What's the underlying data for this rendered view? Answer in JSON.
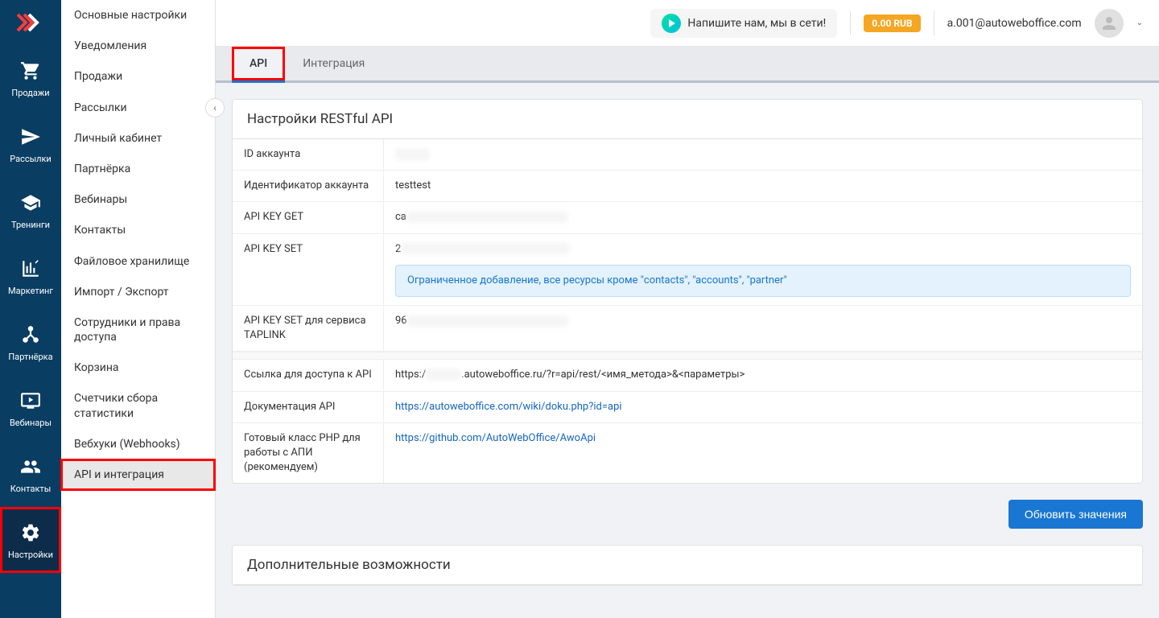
{
  "primaryNav": [
    {
      "label": "Продажи",
      "icon": "cart"
    },
    {
      "label": "Рассылки",
      "icon": "send"
    },
    {
      "label": "Тренинги",
      "icon": "graduation"
    },
    {
      "label": "Маркетинг",
      "icon": "chart"
    },
    {
      "label": "Партнёрка",
      "icon": "network"
    },
    {
      "label": "Вебинары",
      "icon": "monitor"
    },
    {
      "label": "Контакты",
      "icon": "users"
    },
    {
      "label": "Настройки",
      "icon": "gear"
    }
  ],
  "secondaryNav": [
    "Основные настройки",
    "Уведомления",
    "Продажи",
    "Рассылки",
    "Личный кабинет",
    "Партнёрка",
    "Вебинары",
    "Контакты",
    "Файловое хранилище",
    "Импорт / Экспорт",
    "Сотрудники и права доступа",
    "Корзина",
    "Счетчики сбора статистики",
    "Вебхуки (Webhooks)",
    "API и интеграция"
  ],
  "activeSecondaryIndex": 14,
  "topbar": {
    "chatText": "Напишите нам, мы в сети!",
    "balance": "0.00 RUB",
    "email": "a.001@autoweboffice.com"
  },
  "tabs": [
    {
      "label": "API",
      "active": true,
      "highlighted": true
    },
    {
      "label": "Интеграция",
      "active": false,
      "highlighted": false
    }
  ],
  "panel1": {
    "title": "Настройки RESTful API",
    "rows": {
      "accountId": {
        "label": "ID аккаунта",
        "prefix": "",
        "maskWidth": 42
      },
      "accountIdent": {
        "label": "Идентификатор аккаунта",
        "value": "testtest"
      },
      "apiKeyGet": {
        "label": "API KEY GET",
        "prefix": "ca",
        "maskWidth": 200
      },
      "apiKeySet": {
        "label": "API KEY SET",
        "prefix": "2",
        "maskWidth": 210,
        "info": "Ограниченное добавление, все ресурсы кроме \"contacts\", \"accounts\", \"partner\""
      },
      "apiKeyTaplink": {
        "label": "API KEY SET для сервиса TAPLINK",
        "prefix": "96",
        "maskWidth": 200
      }
    },
    "rows2": {
      "accessLink": {
        "label": "Ссылка для доступа к API",
        "prefix": "https:/",
        "suffix": ".autoweboffice.ru/?r=api/rest/<имя_метода>&<параметры>",
        "maskWidth": 44
      },
      "docs": {
        "label": "Документация API",
        "link": "https://autoweboffice.com/wiki/doku.php?id=api"
      },
      "phpClass": {
        "label": "Готовый класс PHP для работы с АПИ (рекомендуем)",
        "link": "https://github.com/AutoWebOffice/AwoApi"
      }
    }
  },
  "updateButton": "Обновить значения",
  "panel2": {
    "title": "Дополнительные возможности"
  }
}
